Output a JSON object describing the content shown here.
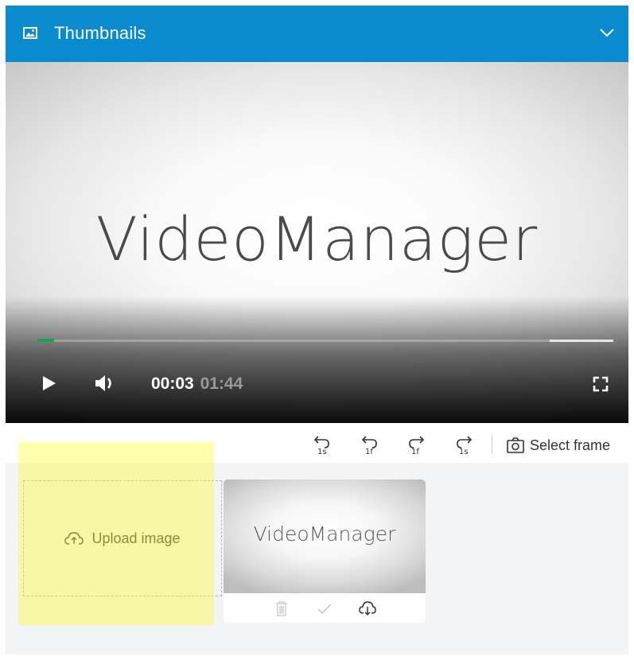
{
  "header": {
    "title": "Thumbnails",
    "icon": "image-icon",
    "toggle_icon": "chevron-down-icon",
    "background": "#0a8bd0"
  },
  "player": {
    "brand_text": "VideoManager",
    "current_time": "00:03",
    "duration": "01:44",
    "progress_fraction": 0.029,
    "buffered_fraction": 0.11,
    "progress_color": "#19a34a",
    "controls": [
      "play-icon",
      "volume-icon",
      "fullscreen-icon"
    ]
  },
  "toolbar": {
    "buttons": [
      {
        "name": "rewind-1s",
        "label": "1s"
      },
      {
        "name": "rewind-1f",
        "label": "1f"
      },
      {
        "name": "forward-1f",
        "label": "1f"
      },
      {
        "name": "forward-1s",
        "label": "1s"
      }
    ],
    "select_frame_label": "Select frame"
  },
  "upload": {
    "label": "Upload image",
    "icon": "cloud-upload-icon"
  },
  "thumbnail": {
    "brand_text": "VideoManager",
    "actions": [
      "trash-icon",
      "check-icon",
      "cloud-download-icon"
    ]
  }
}
